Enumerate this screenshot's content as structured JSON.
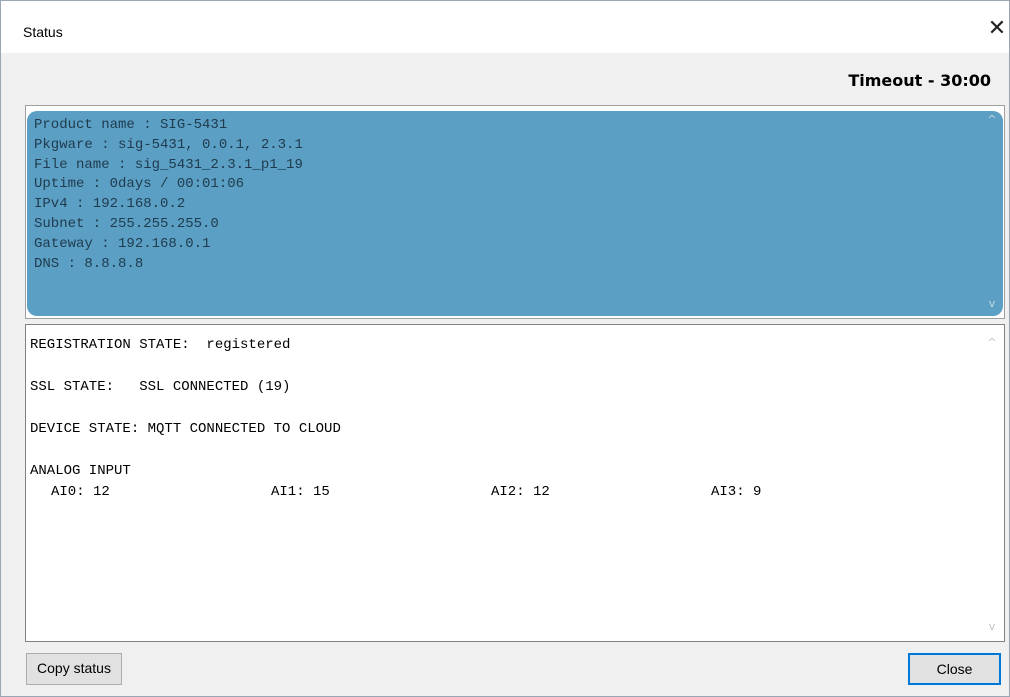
{
  "window": {
    "title": "Status",
    "close_glyph": "✕"
  },
  "timeout_label": "Timeout - 30:00",
  "info_panel": {
    "lines": [
      "Product name : SIG-5431",
      "Pkgware : sig-5431, 0.0.1, 2.3.1",
      "File name : sig_5431_2.3.1_p1_19",
      "Uptime : 0days / 00:01:06",
      "IPv4 : 192.168.0.2",
      "Subnet : 255.255.255.0",
      "Gateway : 192.168.0.1",
      "DNS : 8.8.8.8"
    ],
    "highlight_color": "#5b9fc4"
  },
  "status_panel": {
    "registration": "REGISTRATION STATE:  registered",
    "ssl": "SSL STATE:   SSL CONNECTED (19)",
    "device": "DEVICE STATE: MQTT CONNECTED TO CLOUD",
    "analog_header": "ANALOG INPUT",
    "analog_inputs": [
      "AI0: 12",
      "AI1: 15",
      "AI2: 12",
      "AI3: 9"
    ]
  },
  "scroll_up_glyph": "^",
  "scroll_down_glyph": "v",
  "buttons": {
    "copy_status": "Copy status",
    "close": "Close"
  },
  "colors": {
    "accent": "#0078d7"
  }
}
